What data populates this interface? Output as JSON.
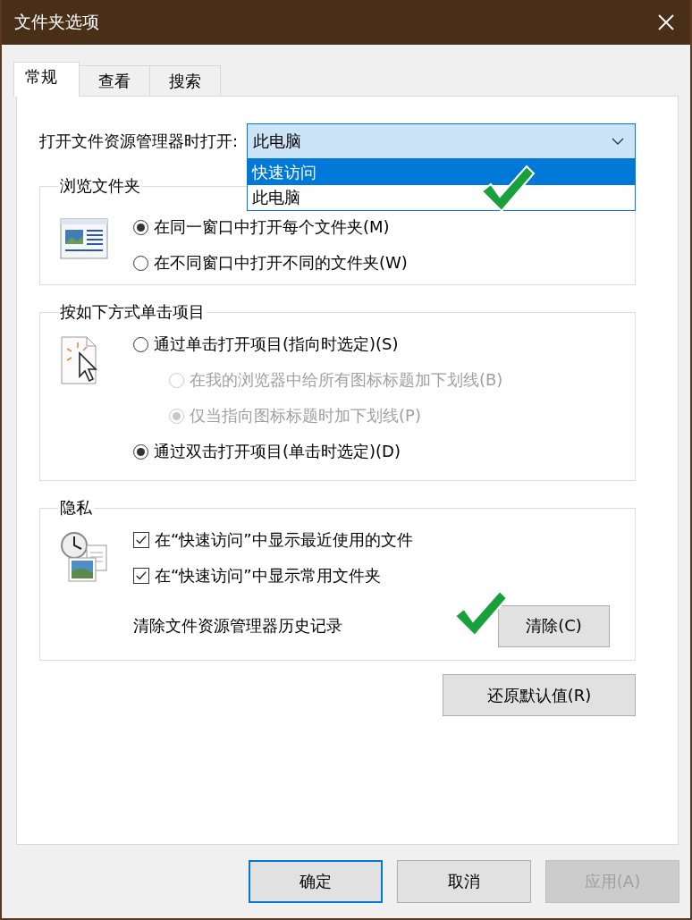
{
  "window": {
    "title": "文件夹选项"
  },
  "tabs": [
    {
      "label": "常规",
      "selected": true
    },
    {
      "label": "查看",
      "selected": false
    },
    {
      "label": "搜索",
      "selected": false
    }
  ],
  "open_in": {
    "label": "打开文件资源管理器时打开:",
    "value": "此电脑",
    "expanded": true,
    "options": [
      {
        "label": "快速访问",
        "highlighted": true
      },
      {
        "label": "此电脑",
        "highlighted": false
      }
    ]
  },
  "groups": [
    {
      "title": "浏览文件夹",
      "kind": "browse",
      "items": [
        {
          "kind": "radio",
          "label": "在同一窗口中打开每个文件夹(M)",
          "selected": true,
          "disabled": false
        },
        {
          "kind": "radio",
          "label": "在不同窗口中打开不同的文件夹(W)",
          "selected": false,
          "disabled": false
        }
      ]
    },
    {
      "title": "按如下方式单击项目",
      "kind": "click",
      "items": [
        {
          "kind": "radio",
          "label": "通过单击打开项目(指向时选定)(S)",
          "selected": false,
          "disabled": false,
          "children": [
            {
              "kind": "radio",
              "label": "在我的浏览器中给所有图标标题加下划线(B)",
              "selected": false,
              "disabled": true
            },
            {
              "kind": "radio",
              "label": "仅当指向图标标题时加下划线(P)",
              "selected": true,
              "disabled": true
            }
          ]
        },
        {
          "kind": "radio",
          "label": "通过双击打开项目(单击时选定)(D)",
          "selected": true,
          "disabled": false
        }
      ]
    },
    {
      "title": "隐私",
      "kind": "privacy",
      "items": [
        {
          "kind": "checkbox",
          "label": "在“快速访问”中显示最近使用的文件",
          "checked": true
        },
        {
          "kind": "checkbox",
          "label": "在“快速访问”中显示常用文件夹",
          "checked": true
        },
        {
          "kind": "action",
          "label": "清除文件资源管理器历史记录",
          "button": "清除(C)"
        }
      ]
    }
  ],
  "restore_button": "还原默认值(R)",
  "buttons": [
    {
      "label": "确定",
      "default": true,
      "disabled": false
    },
    {
      "label": "取消",
      "default": false,
      "disabled": false
    },
    {
      "label": "应用(A)",
      "default": false,
      "disabled": true
    }
  ]
}
